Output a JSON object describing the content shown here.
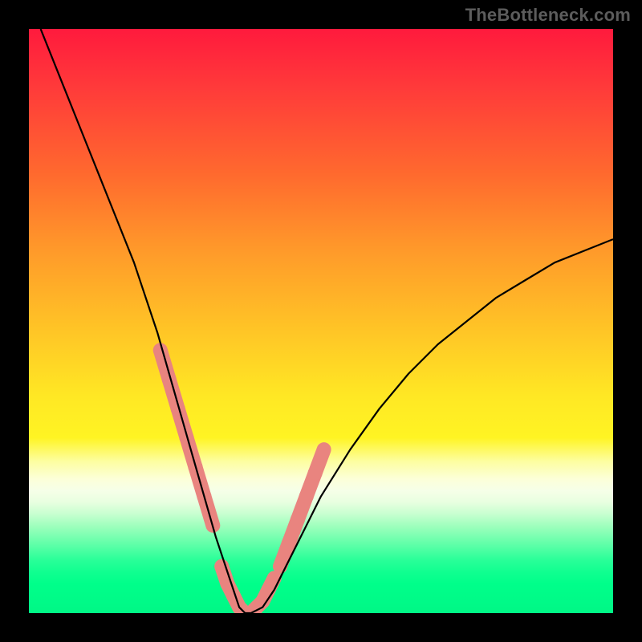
{
  "watermark": "TheBottleneck.com",
  "chart_data": {
    "type": "line",
    "title": "",
    "xlabel": "",
    "ylabel": "",
    "xlim": [
      0,
      100
    ],
    "ylim": [
      0,
      100
    ],
    "series": [
      {
        "name": "bottleneck-curve",
        "x": [
          2,
          6,
          10,
          14,
          18,
          22,
          26,
          28,
          30,
          32,
          34,
          35,
          36,
          37,
          38,
          40,
          42,
          44,
          46,
          50,
          55,
          60,
          65,
          70,
          75,
          80,
          85,
          90,
          95,
          100
        ],
        "y": [
          100,
          90,
          80,
          70,
          60,
          48,
          34,
          27,
          20,
          13,
          7,
          4,
          1,
          0,
          0,
          1,
          4,
          8,
          12,
          20,
          28,
          35,
          41,
          46,
          50,
          54,
          57,
          60,
          62,
          64
        ]
      }
    ],
    "highlight_segments": [
      {
        "name": "left-highlight",
        "x": [
          22.5,
          24,
          25.5,
          27,
          28.5,
          30,
          31.5
        ],
        "y": [
          45,
          40,
          35,
          30,
          25,
          20,
          15
        ]
      },
      {
        "name": "bottom-highlight",
        "x": [
          33,
          34,
          35,
          36,
          37,
          38,
          39,
          40,
          41,
          42
        ],
        "y": [
          8,
          5,
          3,
          1,
          0,
          0,
          1,
          2,
          4,
          6
        ]
      },
      {
        "name": "right-highlight",
        "x": [
          43,
          44.5,
          46,
          47.5,
          49,
          50.5
        ],
        "y": [
          8,
          12,
          16,
          20,
          24,
          28
        ]
      }
    ],
    "highlight_color": "#e9847f",
    "curve_color": "#000000"
  }
}
